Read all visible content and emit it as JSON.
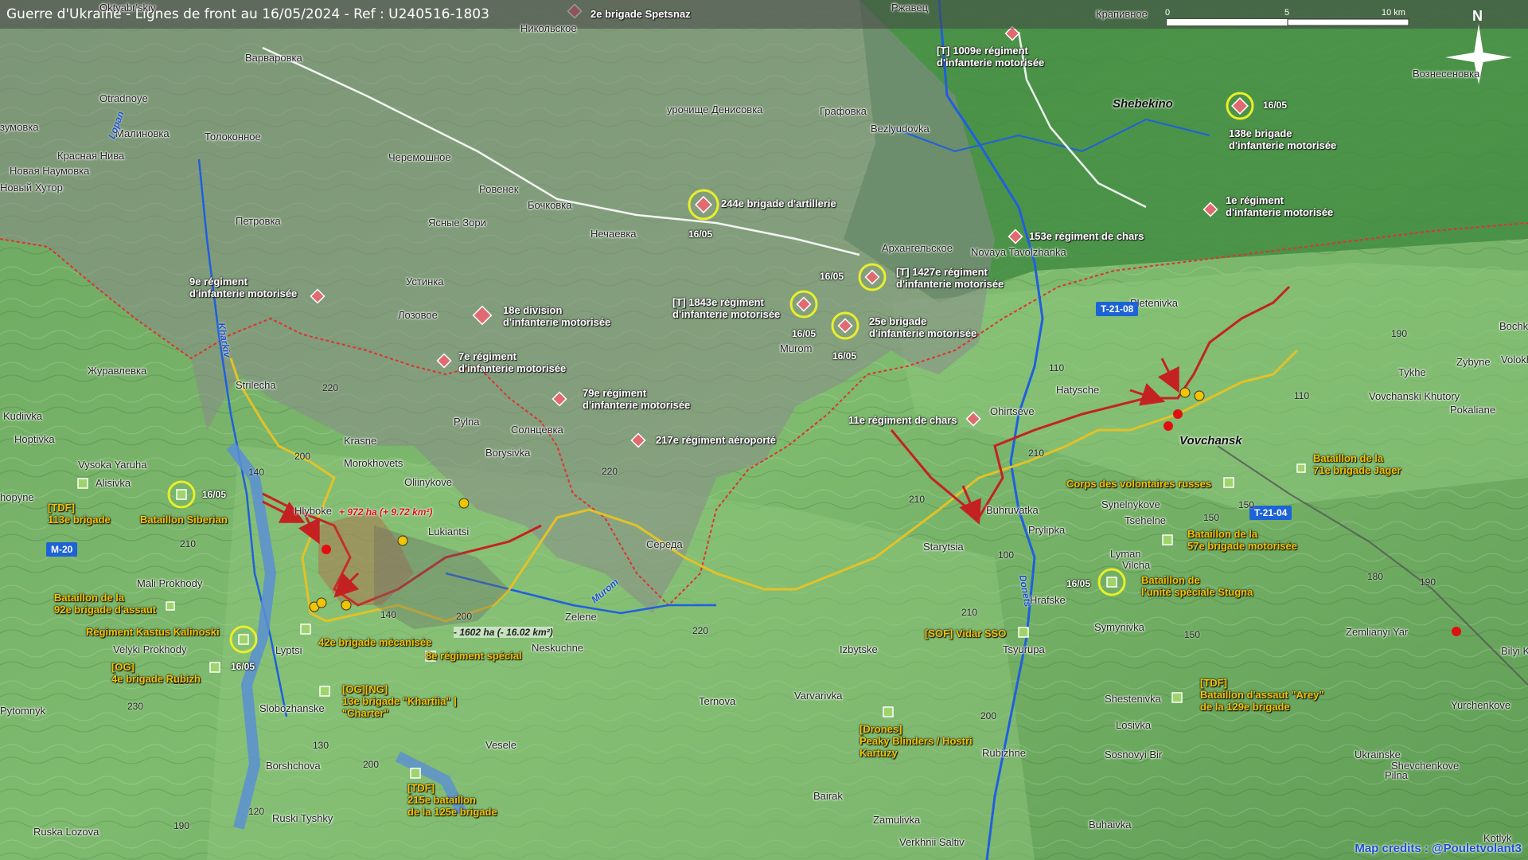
{
  "title": "Guerre d'Ukraine - Lignes de front au 16/05/2024 - Ref : U240516-1803",
  "credits": "Map credits : @Pouletvolant3",
  "scale": {
    "labels": [
      "0",
      "5",
      "10 km"
    ]
  },
  "compass": {
    "label": "N"
  },
  "places": [
    {
      "id": "oktyabrskiy",
      "text": "Oktyabr'skiy"
    },
    {
      "id": "nikolskoe",
      "text": "Никольское"
    },
    {
      "id": "rzhavets",
      "text": "Ржавец"
    },
    {
      "id": "krapivnoe",
      "text": "Крапивное"
    },
    {
      "id": "varvarovka",
      "text": "Варваровка"
    },
    {
      "id": "voznesenovka",
      "text": "Вознесеновка"
    },
    {
      "id": "otradnoye",
      "text": "Otradnoye"
    },
    {
      "id": "zumovka",
      "text": "зумовка"
    },
    {
      "id": "malinovka",
      "text": "Малиновка"
    },
    {
      "id": "tolokonnoe",
      "text": "Толоконное"
    },
    {
      "id": "urochishche",
      "text": "урочище Денисовка"
    },
    {
      "id": "grafovka",
      "text": "Графовка"
    },
    {
      "id": "bezlyudovka",
      "text": "Bezlyudovka"
    },
    {
      "id": "krasnaya_niva",
      "text": "Красная Нива"
    },
    {
      "id": "chermoshnoe",
      "text": "Черемошное"
    },
    {
      "id": "novaya_naumovka",
      "text": "Новая Наумовка"
    },
    {
      "id": "novy_khutor",
      "text": "Новый Хутор"
    },
    {
      "id": "rovenek",
      "text": "Ровенек"
    },
    {
      "id": "bochkovka",
      "text": "Бочковка"
    },
    {
      "id": "petrovka",
      "text": "Петровка"
    },
    {
      "id": "yasnye_zori",
      "text": "Ясные Зори"
    },
    {
      "id": "nechaevka",
      "text": "Нечаевка"
    },
    {
      "id": "arkhangelskoe",
      "text": "Архангельское"
    },
    {
      "id": "novaya_tavolzhanka",
      "text": "Novaya Tavolzhanka"
    },
    {
      "id": "ustinka",
      "text": "Устинка"
    },
    {
      "id": "lozovoe",
      "text": "Лозовое"
    },
    {
      "id": "pletenivka",
      "text": "Pletenivka"
    },
    {
      "id": "bochk",
      "text": "Bochk"
    },
    {
      "id": "zhuravlevka",
      "text": "Журавлевка"
    },
    {
      "id": "murom",
      "text": "Murom"
    },
    {
      "id": "tykhe",
      "text": "Tykhe"
    },
    {
      "id": "zybyne",
      "text": "Zybyne"
    },
    {
      "id": "volokh",
      "text": "Volokh"
    },
    {
      "id": "strilecha",
      "text": "Strilecha"
    },
    {
      "id": "hatysche",
      "text": "Hatysche"
    },
    {
      "id": "vovchanski_khutory",
      "text": "Vovchanski Khutory"
    },
    {
      "id": "pokaliane",
      "text": "Pokaliane"
    },
    {
      "id": "kudiivka",
      "text": "Kudiivka"
    },
    {
      "id": "pylna",
      "text": "Pylna"
    },
    {
      "id": "krasne",
      "text": "Krasne"
    },
    {
      "id": "solntsevka",
      "text": "Солнцевка"
    },
    {
      "id": "ohirtseve",
      "text": "Ohirtseve"
    },
    {
      "id": "hoptivka",
      "text": "Hoptivka"
    },
    {
      "id": "borysivka",
      "text": "Borysivka"
    },
    {
      "id": "morokhovets",
      "text": "Morokhovets"
    },
    {
      "id": "vysoka_yaruha",
      "text": "Vysoka Yaruha"
    },
    {
      "id": "alisivka",
      "text": "Alisivka"
    },
    {
      "id": "oliinykove",
      "text": "Oliinykove"
    },
    {
      "id": "hopyne",
      "text": "hopyne"
    },
    {
      "id": "hlyboke",
      "text": "Hlyboke"
    },
    {
      "id": "buhruvatka",
      "text": "Buhruvatka"
    },
    {
      "id": "synelnykove",
      "text": "Synelnykove"
    },
    {
      "id": "lukiantsi",
      "text": "Lukiantsi"
    },
    {
      "id": "prylipka",
      "text": "Prylipka"
    },
    {
      "id": "tsehelne",
      "text": "Tsehelne"
    },
    {
      "id": "sereda",
      "text": "Середа"
    },
    {
      "id": "starytsia",
      "text": "Starytsia"
    },
    {
      "id": "lyman",
      "text": "Lyman"
    },
    {
      "id": "mali_prokhody",
      "text": "Mali Prokhody"
    },
    {
      "id": "vilcha",
      "text": "Vilcha"
    },
    {
      "id": "zelene",
      "text": "Zelene"
    },
    {
      "id": "hrafske",
      "text": "Hrafske"
    },
    {
      "id": "symynivka",
      "text": "Symynivka"
    },
    {
      "id": "zemlianyi_yar",
      "text": "Zemlianyi Yar"
    },
    {
      "id": "lyptsi",
      "text": "Lyptsi"
    },
    {
      "id": "neskuchne",
      "text": "Neskuchne"
    },
    {
      "id": "velyki_prokhody",
      "text": "Velyki Prokhody"
    },
    {
      "id": "izbytske",
      "text": "Izbytske"
    },
    {
      "id": "tsyurupa",
      "text": "Tsyurupa"
    },
    {
      "id": "bilyi_kolodiaz",
      "text": "Bilyi Ko"
    },
    {
      "id": "pytomnyk",
      "text": "Pytomnyk"
    },
    {
      "id": "slobozhanske",
      "text": "Slobozhanske"
    },
    {
      "id": "ternova",
      "text": "Ternova"
    },
    {
      "id": "varvarivka",
      "text": "Varvarivka"
    },
    {
      "id": "shestenivka",
      "text": "Shestenivka"
    },
    {
      "id": "yurchenkove",
      "text": "Yurchenkove"
    },
    {
      "id": "losivka",
      "text": "Losivka"
    },
    {
      "id": "vesele",
      "text": "Vesele"
    },
    {
      "id": "rubizhne",
      "text": "Rubizhne"
    },
    {
      "id": "sosnovyi_bir",
      "text": "Sosnovyi Bir"
    },
    {
      "id": "ukrainske",
      "text": "Ukrainske"
    },
    {
      "id": "shevchenkove",
      "text": "Shevchenkove"
    },
    {
      "id": "borshchova",
      "text": "Borshchova"
    },
    {
      "id": "pilna",
      "text": "Pilna"
    },
    {
      "id": "ruski_tyshky",
      "text": "Ruski Tyshky"
    },
    {
      "id": "bairak",
      "text": "Bairak"
    },
    {
      "id": "zamulivka",
      "text": "Zamulivka"
    },
    {
      "id": "buhaivka",
      "text": "Buhaivka"
    },
    {
      "id": "ruska_lozova",
      "text": "Ruska Lozova"
    },
    {
      "id": "verkhnii_saltiv",
      "text": "Verkhnii Saltiv"
    },
    {
      "id": "kotlyk",
      "text": "Kotlyk"
    }
  ],
  "towns": [
    {
      "id": "shebekino",
      "text": "Shebekino"
    },
    {
      "id": "vovchansk",
      "text": "Vovchansk"
    }
  ],
  "rivers": [
    {
      "id": "lopan",
      "text": "Lopan"
    },
    {
      "id": "kharkiv",
      "text": "Kharkiv"
    },
    {
      "id": "murom_river",
      "text": "Murom"
    },
    {
      "id": "donets",
      "text": "Donets"
    }
  ],
  "roads": [
    {
      "id": "t2108",
      "text": "T-21-08"
    },
    {
      "id": "t2104",
      "text": "T-21-04"
    },
    {
      "id": "m20",
      "text": "M-20"
    }
  ],
  "elevations": [
    "220",
    "200",
    "140",
    "210",
    "220",
    "110",
    "110",
    "210",
    "210",
    "190",
    "150",
    "150",
    "180",
    "190",
    "210",
    "200",
    "220",
    "140",
    "230",
    "200",
    "130",
    "200",
    "210",
    "150",
    "120",
    "190",
    "100"
  ],
  "russian_units": [
    {
      "id": "spetsnaz",
      "text": "2e brigade Spetsnaz",
      "echelon": "X"
    },
    {
      "id": "r1009",
      "text": "[T] 1009e régiment\nd'infanterie motorisée",
      "echelon": "III"
    },
    {
      "id": "b138",
      "text": "138e brigade\nd'infanterie motorisée",
      "echelon": "X",
      "date": "16/05"
    },
    {
      "id": "b244",
      "text": "244e brigade d'artillerie",
      "echelon": "X",
      "date": "16/05"
    },
    {
      "id": "r1e",
      "text": "1e régiment\nd'infanterie motorisée",
      "echelon": "III"
    },
    {
      "id": "r153",
      "text": "153e régiment de chars",
      "echelon": "III"
    },
    {
      "id": "r9e",
      "text": "9e régiment\nd'infanterie motorisée",
      "echelon": "III"
    },
    {
      "id": "d18e",
      "text": "18e division\nd'infanterie motorisée",
      "echelon": "XX"
    },
    {
      "id": "r1427",
      "text": "[T] 1427e régiment\nd'infanterie motorisée",
      "echelon": "III",
      "date": "16/05"
    },
    {
      "id": "r1843",
      "text": "[T] 1843e régiment\nd'infanterie motorisée",
      "echelon": "III",
      "date": "16/05"
    },
    {
      "id": "b25e",
      "text": "25e brigade\nd'infanterie motorisée",
      "echelon": "X",
      "date": "16/05"
    },
    {
      "id": "r7e",
      "text": "7e régiment\nd'infanterie motorisée",
      "echelon": "III"
    },
    {
      "id": "r79e",
      "text": "79e régiment\nd'infanterie motorisée",
      "echelon": "III"
    },
    {
      "id": "r217e",
      "text": "217e régiment aéroporté",
      "echelon": "III"
    },
    {
      "id": "r11e",
      "text": "11e régiment de chars",
      "echelon": "III"
    }
  ],
  "ukrainian_units": [
    {
      "id": "tdf113",
      "text": "[TDF]\n113e brigade"
    },
    {
      "id": "siberian",
      "text": "Bataillon Siberian",
      "date": "16/05"
    },
    {
      "id": "b92",
      "text": "Bataillon de la\n92e brigade d'assaut"
    },
    {
      "id": "kalinoski",
      "text": "Régiment Kastus Kalinoski",
      "date": "16/05"
    },
    {
      "id": "og4",
      "text": "[OG]\n4e brigade Rubizh"
    },
    {
      "id": "b42",
      "text": "42e brigade mécanisée"
    },
    {
      "id": "r8",
      "text": "8e régiment spécial"
    },
    {
      "id": "og13",
      "text": "[OG][NG]\n13e brigade \"Khartiia\" |\n\"Charter\""
    },
    {
      "id": "tdf215",
      "text": "[TDF]\n215e bataillon\nde la 125e brigade"
    },
    {
      "id": "drones",
      "text": "[Drones]\nPeaky Blinders / Hostri\nKartuzy"
    },
    {
      "id": "vidar",
      "text": "[SOF] Vidar SSO"
    },
    {
      "id": "stugna",
      "text": "Bataillon de\nl'unité spéciale Stugna",
      "date": "16/05"
    },
    {
      "id": "b57",
      "text": "Bataillon de la\n57e brigade motorisée"
    },
    {
      "id": "corps_ru",
      "text": "Corps des volontaires russes"
    },
    {
      "id": "b71",
      "text": "Bataillon de la\n71e brigade Jager"
    },
    {
      "id": "arey",
      "text": "[TDF]\nBataillon d'assaut \"Arey\"\nde la 129e brigade"
    }
  ],
  "territory_changes": {
    "gain": "+ 972 ha (+ 9.72 km²)",
    "loss": "- 1602 ha (- 16.02 km²)"
  },
  "colors": {
    "russian_unit": "#e06a70",
    "front_line_ru": "#c42222",
    "front_line_ua": "#e3c227",
    "border": "#d33",
    "river": "#1f5fe0",
    "occupied_overlay": "#777777",
    "road_badge": "#1d63d6"
  }
}
